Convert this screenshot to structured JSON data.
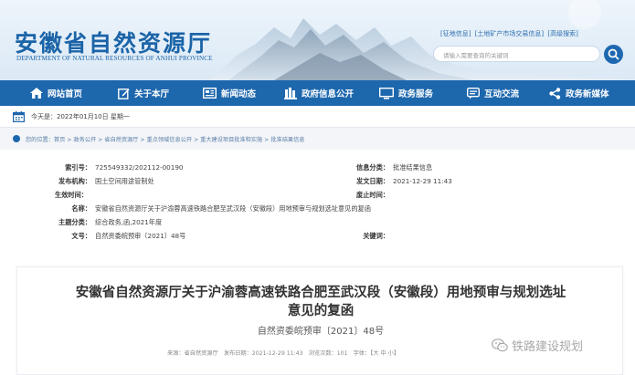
{
  "header": {
    "logo_cn": "安徽省自然资源厅",
    "logo_en": "DEPARTMENT OF NATURAL RESOURCES OF ANHUI PROVINCE",
    "top_links": [
      "[征地信息]",
      "[土地矿产市场交易信息]",
      "[高级搜索]"
    ],
    "search_placeholder": "请输入需要查询的关键词",
    "colors": {
      "brand_blue": "#1d67ad"
    }
  },
  "nav": {
    "items": [
      {
        "label": "网站首页",
        "icon": "home-icon"
      },
      {
        "label": "关于本厅",
        "icon": "edit-icon"
      },
      {
        "label": "新闻动态",
        "icon": "newspaper-icon"
      },
      {
        "label": "政府信息公开",
        "icon": "books-icon"
      },
      {
        "label": "政务服务",
        "icon": "monitor-icon"
      },
      {
        "label": "互动交流",
        "icon": "chat-icon"
      },
      {
        "label": "政务新媒体",
        "icon": "share-icon"
      }
    ]
  },
  "date_bar": {
    "text": "今天是：2022年01月10日 星期一"
  },
  "breadcrumb": {
    "text": "您的位置：首页 > 政务公开 > 省自然资源厅 > 重点领域信息公开 > 重大建设项目批准和实施 > 批准结果信息"
  },
  "meta": {
    "index_label": "索引号：",
    "index_value": "725549332/202112-00190",
    "category_label": "信息分类：",
    "category_value": "批准结果信息",
    "publisher_label": "发布机构：",
    "publisher_value": "国土空间用途管制处",
    "date_label": "发文日期：",
    "date_value": "2021-12-29 11:43",
    "effective_label": "生效时间：",
    "effective_value": "",
    "expire_label": "废止时间：",
    "expire_value": "",
    "name_label": "名称：",
    "name_value": "安徽省自然资源厅关于沪渝蓉高速铁路合肥至武汉段（安徽段）用地预审与规划选址意见的复函",
    "topic_label": "主题分类：",
    "topic_value": "综合政务,函,2021年度",
    "docno_label": "文号：",
    "docno_value": "自然资委皖预审〔2021〕48号",
    "keyword_label": "关键词：",
    "keyword_value": ""
  },
  "article": {
    "title_line1": "安徽省自然资源厅关于沪渝蓉高速铁路合肥至武汉段（安徽段）用地预审与规划选址",
    "title_line2": "意见的复函",
    "doc_number": "自然资委皖预审〔2021〕48号",
    "meta_line": "来源：省自然资源厅　发布日期：2021-12-29 11:43　浏览次数：101　字体：【大 中 小】"
  },
  "watermark": {
    "text": "铁路建设规划"
  }
}
